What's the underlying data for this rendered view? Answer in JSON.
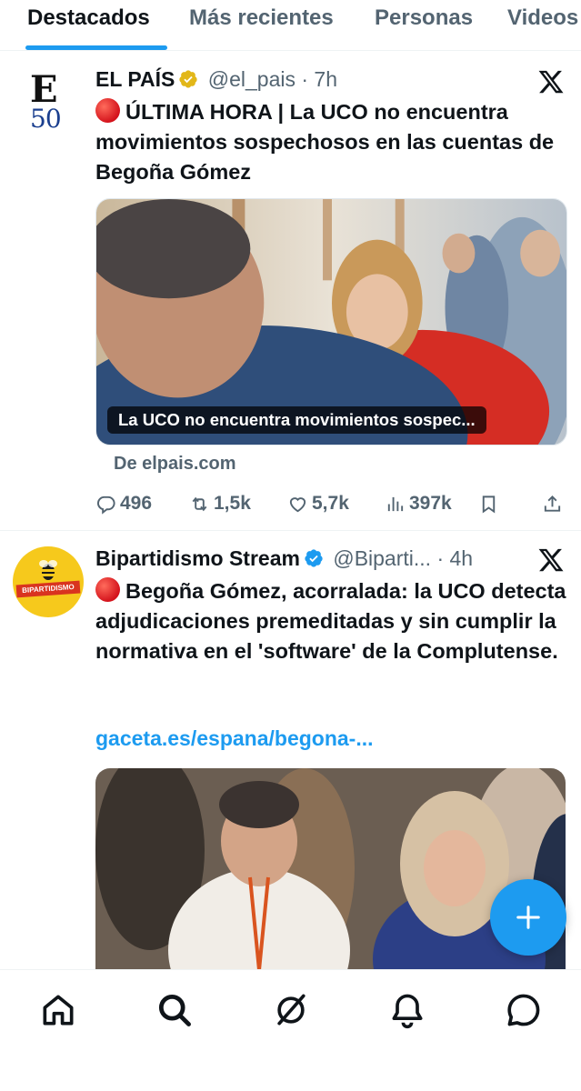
{
  "tabs": [
    "Destacados",
    "Más recientes",
    "Personas",
    "Videos"
  ],
  "active_tab": "Destacados",
  "colors": {
    "accent": "#1d9bf0",
    "verified_gold": "#e2b719",
    "verified_blue": "#1d9bf0",
    "breaking_red": "#d4131c"
  },
  "posts": [
    {
      "author": "EL PAÍS",
      "handle": "@el_pais",
      "separator": "·",
      "time": "7h",
      "verified": "gold-checkmark-icon",
      "avatar": {
        "logo_letter": "E",
        "logo_number": "50"
      },
      "text": "ÚLTIMA HORA | La UCO no encuentra movimientos sospechosos en las cuentas de Begoña Gómez",
      "card": {
        "caption": "La UCO no encuentra movimientos sospec...",
        "source": "De elpais.com"
      },
      "stats": {
        "replies": "496",
        "reposts": "1,5k",
        "likes": "5,7k",
        "views": "397k"
      }
    },
    {
      "author": "Bipartidismo Stream",
      "handle": "@Biparti...",
      "separator": "·",
      "time": "4h",
      "verified": "blue-checkmark-icon",
      "avatar": {
        "label": "BIPARTIDISMO"
      },
      "text": "Begoña Gómez, acorralada: la UCO detecta adjudicaciones premeditadas y sin cumplir la normativa en el 'software' de la Complutense.",
      "link": "gaceta.es/espana/begona-..."
    }
  ],
  "bottom_nav": [
    "home-icon",
    "search-icon",
    "grok-icon",
    "notifications-icon",
    "messages-icon"
  ]
}
